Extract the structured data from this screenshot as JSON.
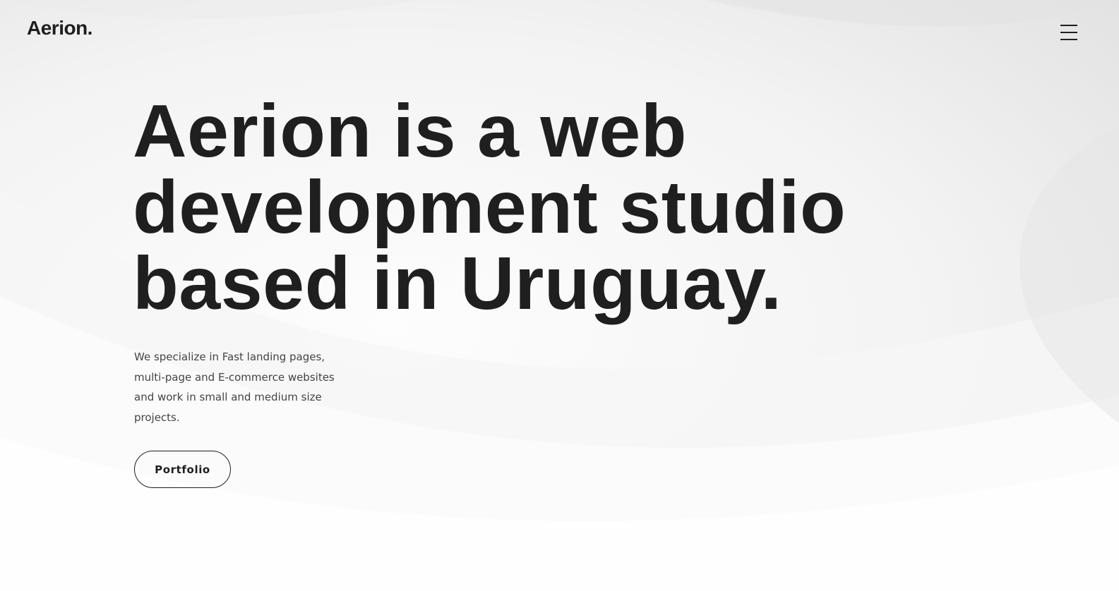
{
  "header": {
    "logo_text": "Aerion.",
    "menu_icon": "hamburger-menu-icon"
  },
  "hero": {
    "title_lines": [
      "Aerion is a web",
      "development studio",
      "based in Uruguay."
    ],
    "description_lines": [
      "We specialize in Fast landing pages,",
      "multi-page and E-commerce websites",
      "and work in small and medium size",
      "projects."
    ],
    "cta_label": "Portfolio"
  },
  "colors": {
    "text": "#1f1f1f",
    "body_text": "#444444",
    "background_light": "#fafafa",
    "background_shade": "#e2e2e2"
  }
}
